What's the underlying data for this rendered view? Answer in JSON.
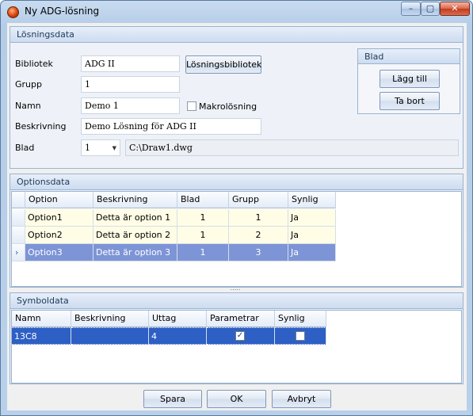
{
  "window": {
    "title": "Ny ADG-lösning",
    "minimize": "–",
    "maximize": "▢",
    "close": "✕"
  },
  "losningsdata": {
    "header": "Lösningsdata",
    "bibliotek_label": "Bibliotek",
    "bibliotek_value": "ADG II",
    "losningsbibliotek_button": "Lösningsbibliotek",
    "grupp_label": "Grupp",
    "grupp_value": "1",
    "namn_label": "Namn",
    "namn_value": "Demo 1",
    "makro_label": "Makrolösning",
    "beskrivning_label": "Beskrivning",
    "beskrivning_value": "Demo Lösning för ADG II",
    "blad_label": "Blad",
    "blad_value": "1",
    "blad_path": "C:\\Draw1.dwg"
  },
  "blad_panel": {
    "header": "Blad",
    "add_button": "Lägg till",
    "remove_button": "Ta bort"
  },
  "optionsdata": {
    "header": "Optionsdata",
    "columns": [
      "Option",
      "Beskrivning",
      "Blad",
      "Grupp",
      "Synlig"
    ],
    "rows": [
      {
        "option": "Option1",
        "beskrivning": "Detta är option 1",
        "blad": "1",
        "grupp": "1",
        "synlig": "Ja"
      },
      {
        "option": "Option2",
        "beskrivning": "Detta är option 2",
        "blad": "1",
        "grupp": "2",
        "synlig": "Ja"
      },
      {
        "option": "Option3",
        "beskrivning": "Detta är option 3",
        "blad": "1",
        "grupp": "3",
        "synlig": "Ja"
      }
    ],
    "selected_marker": "›",
    "splitter": "....."
  },
  "symboldata": {
    "header": "Symboldata",
    "columns": [
      "Namn",
      "Beskrivning",
      "Uttag",
      "Parametrar",
      "Synlig"
    ],
    "rows": [
      {
        "namn": "13C8",
        "beskrivning": "",
        "uttag": "4",
        "parametrar": true,
        "synlig": false
      }
    ]
  },
  "footer": {
    "spara": "Spara",
    "ok": "OK",
    "avbryt": "Avbryt"
  }
}
